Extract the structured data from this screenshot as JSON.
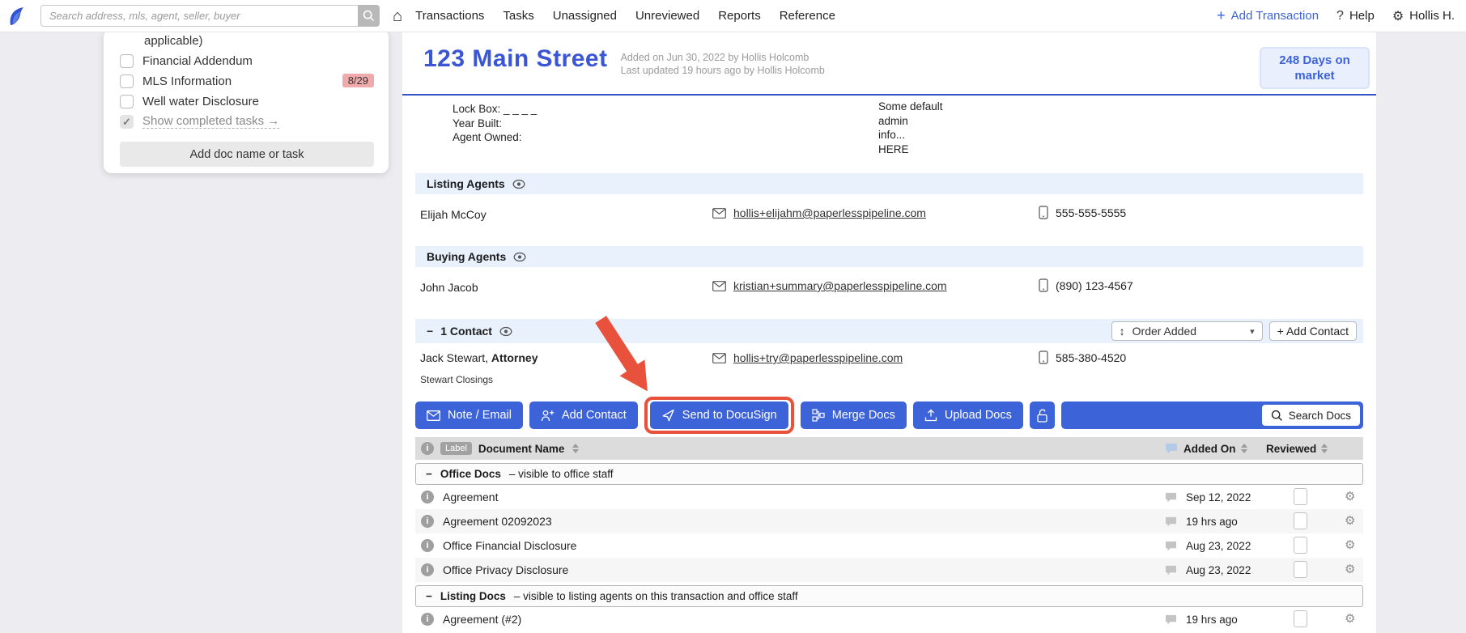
{
  "icons": {
    "home": "⌂",
    "gear": "⚙",
    "question": "?",
    "plus": "+",
    "check": "✓",
    "minus": "−",
    "caret_down": "▾",
    "updown": "↕"
  },
  "topbar": {
    "search_placeholder": "Search address, mls, agent, seller, buyer",
    "nav": [
      "Transactions",
      "Tasks",
      "Unassigned",
      "Unreviewed",
      "Reports",
      "Reference"
    ],
    "add_transaction": "Add Transaction",
    "help": "Help",
    "user": "Hollis H."
  },
  "sidebar": {
    "overflow_text": "applicable)",
    "items": [
      {
        "label": "Financial Addendum"
      },
      {
        "label": "MLS Information",
        "badge": "8/29"
      },
      {
        "label": "Well water Disclosure"
      }
    ],
    "show_completed": "Show completed tasks →",
    "add_button": "Add doc name or task"
  },
  "header": {
    "title": "123 Main Street",
    "added_line": "Added on Jun 30, 2022 by Hollis Holcomb",
    "updated_line": "Last updated 19 hours ago by Hollis Holcomb",
    "days_line1": "248 Days on",
    "days_line2": "market"
  },
  "details": {
    "left": [
      "Lock Box: _ _ _ _",
      "Year Built:",
      "Agent Owned:"
    ],
    "right": [
      "Some default",
      "admin",
      "info...",
      "HERE"
    ]
  },
  "listing_agents": {
    "title": "Listing Agents",
    "agents": [
      {
        "name": "Elijah McCoy",
        "email": "hollis+elijahm@paperlesspipeline.com",
        "phone": "555-555-5555"
      }
    ]
  },
  "buying_agents": {
    "title": "Buying Agents",
    "agents": [
      {
        "name": "John Jacob",
        "email": "kristian+summary@paperlesspipeline.com",
        "phone": "(890) 123-4567"
      }
    ]
  },
  "contacts": {
    "title": "1 Contact",
    "sort_label": "Order Added",
    "add_button": "+ Add Contact",
    "rows": [
      {
        "name": "Jack Stewart,",
        "role": "Attorney",
        "company": "Stewart Closings",
        "email": "hollis+try@paperlesspipeline.com",
        "phone": "585-380-4520"
      }
    ]
  },
  "toolbar": {
    "note_email": "Note / Email",
    "add_contact": "Add Contact",
    "send_docusign": "Send to DocuSign",
    "merge_docs": "Merge Docs",
    "upload_docs": "Upload Docs",
    "search_docs": "Search Docs"
  },
  "doc_table": {
    "label_badge": "Label",
    "col_name": "Document Name",
    "col_added": "Added On",
    "col_reviewed": "Reviewed",
    "groups": [
      {
        "title": "Office Docs",
        "subtitle": "– visible to office staff",
        "rows": [
          {
            "name": "Agreement",
            "added": "Sep 12, 2022"
          },
          {
            "name": "Agreement 02092023",
            "added": "19 hrs ago"
          },
          {
            "name": "Office Financial Disclosure",
            "added": "Aug 23, 2022"
          },
          {
            "name": "Office Privacy Disclosure",
            "added": "Aug 23, 2022"
          }
        ]
      },
      {
        "title": "Listing Docs",
        "subtitle": "– visible to listing agents on this transaction and office staff",
        "rows": [
          {
            "name": "Agreement (#2)",
            "added": "19 hrs ago"
          }
        ]
      }
    ]
  },
  "colors": {
    "primary_blue": "#3d63d9",
    "title_blue": "#3a56d4",
    "banner_blue": "#e9f1fd",
    "badge_pink": "#efabab",
    "annotation_red": "#e8513b"
  }
}
